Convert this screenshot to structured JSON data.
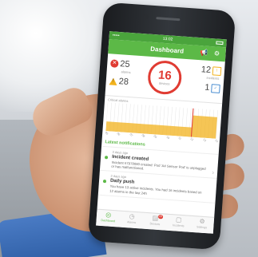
{
  "status_bar": {
    "time": "13:02",
    "signal": "•••••"
  },
  "app": {
    "title": "Dashboard"
  },
  "stats": {
    "alarms": {
      "value": "25",
      "label": "alarms"
    },
    "warnings": {
      "value": "28",
      "label": ""
    },
    "devices": {
      "value": "16",
      "label": "devices"
    },
    "incidents": {
      "value": "12",
      "label": "incidents"
    },
    "acknowledged": {
      "value": "1",
      "label": ""
    }
  },
  "chart_data": {
    "type": "area",
    "title": "Critical alarms",
    "x": [
      "05",
      "06",
      "07",
      "08",
      "09",
      "10",
      "11",
      "12",
      "13",
      "14"
    ],
    "series": [
      {
        "values": [
          4,
          4,
          4,
          4,
          4,
          4,
          4,
          9,
          9,
          9
        ],
        "color": "#f2b21c"
      }
    ],
    "ylim": [
      0,
      12
    ],
    "grid": true
  },
  "notifications": {
    "header": "Latest notifications",
    "items": [
      {
        "when": "3 days ago",
        "title": "Incident created",
        "body": "Incident #7978080 created: Pod 'A4 Sensor Pod' is unplugged or has malfunctioned."
      },
      {
        "when": "3 days ago",
        "title": "Daily push",
        "body": "You have 13 active incidents. You had 16 incidents based on 12 alarms in the last 24h"
      }
    ]
  },
  "tabs": [
    {
      "label": "Dashboard",
      "icon": "dashboard-icon",
      "glyph": "◎"
    },
    {
      "label": "Alarms",
      "icon": "alarm-icon",
      "glyph": "◷"
    },
    {
      "label": "Devices",
      "icon": "devices-icon",
      "glyph": "▤",
      "badge": "16"
    },
    {
      "label": "Incidents",
      "icon": "incidents-icon",
      "glyph": "▢"
    },
    {
      "label": "Settings",
      "icon": "settings-icon",
      "glyph": "⚙"
    }
  ]
}
